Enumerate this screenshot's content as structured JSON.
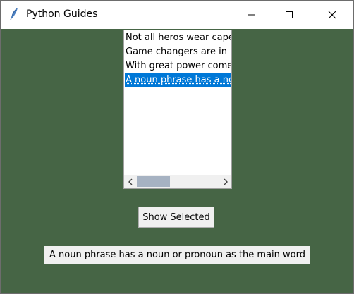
{
  "window": {
    "title": "Python Guides",
    "app_icon": "feather-icon",
    "controls": {
      "minimize_icon": "minimize-icon",
      "maximize_icon": "maximize-icon",
      "close_icon": "close-icon"
    }
  },
  "colors": {
    "background": "#466545",
    "selection": "#0078d7",
    "scroll_thumb": "#a6b2c2"
  },
  "listbox": {
    "items": [
      {
        "label": "Not all heros wear capes"
      },
      {
        "label": "Game changers are in blue"
      },
      {
        "label": "With great power comes great responsibility"
      },
      {
        "label": "A noun phrase has a noun or pronoun as the main word"
      }
    ],
    "selected_index": 3
  },
  "buttons": {
    "show_selected": "Show Selected"
  },
  "result": {
    "text": "A noun phrase has a noun or pronoun as the main word"
  }
}
